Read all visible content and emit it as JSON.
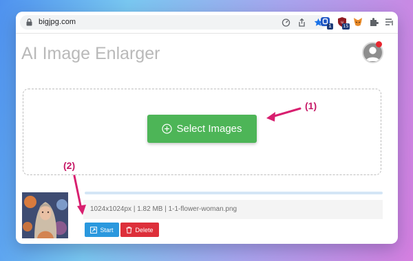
{
  "browser": {
    "url": "bigjpg.com",
    "icons": [
      "lock-icon",
      "speed-icon",
      "share-icon",
      "bookmark-star-icon"
    ],
    "extensions": [
      {
        "name": "extension-blue-icon",
        "badge": "1"
      },
      {
        "name": "extension-red-icon",
        "badge": "15"
      },
      {
        "name": "metamask-fox-icon"
      },
      {
        "name": "extensions-puzzle-icon"
      },
      {
        "name": "reading-list-icon"
      }
    ]
  },
  "app": {
    "title": "AI Image Enlarger",
    "select_button_label": "Select Images"
  },
  "annotations": {
    "step1": "(1)",
    "step2": "(2)"
  },
  "file": {
    "info": "1024x1024px | 1.82 MB | 1-1-flower-woman.png",
    "start_label": "Start",
    "delete_label": "Delete"
  },
  "colors": {
    "select_button": "#4db557",
    "start_button": "#2a98de",
    "delete_button": "#dd2f3a",
    "annotation": "#c61866",
    "title": "#b9b9b9"
  }
}
